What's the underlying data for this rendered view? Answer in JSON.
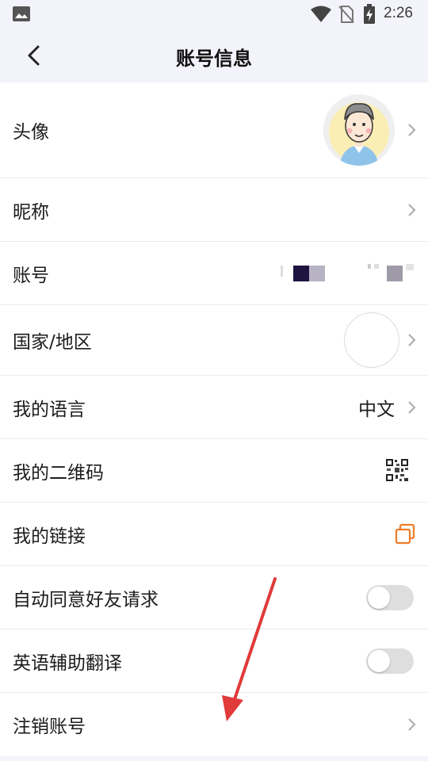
{
  "status_bar": {
    "time": "2:26",
    "icons": [
      "image-icon",
      "wifi-icon",
      "no-sim-icon",
      "battery-charging-icon"
    ]
  },
  "header": {
    "title": "账号信息",
    "back_icon": "chevron-left-icon"
  },
  "rows": {
    "avatar": {
      "label": "头像"
    },
    "nickname": {
      "label": "昵称"
    },
    "account": {
      "label": "账号",
      "value_note": "account number partially masked"
    },
    "region": {
      "label": "国家/地区"
    },
    "language": {
      "label": "我的语言",
      "value": "中文"
    },
    "qrcode": {
      "label": "我的二维码"
    },
    "link": {
      "label": "我的链接"
    },
    "auto_accept": {
      "label": "自动同意好友请求",
      "enabled": false
    },
    "english_assist": {
      "label": "英语辅助翻译",
      "enabled": false
    },
    "deactivate": {
      "label": "注销账号"
    }
  },
  "colors": {
    "accent_orange": "#f07d28",
    "annotation_red": "#e03a3a",
    "toggle_off": "#dedede"
  }
}
